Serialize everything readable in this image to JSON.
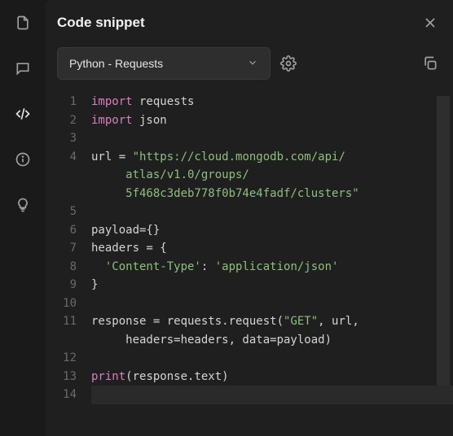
{
  "panel": {
    "title": "Code snippet"
  },
  "language_select": {
    "selected": "Python - Requests"
  },
  "code": {
    "lines": [
      {
        "n": 1,
        "segments": [
          {
            "cls": "kw",
            "t": "import"
          },
          {
            "cls": "ident",
            "t": " requests"
          }
        ]
      },
      {
        "n": 2,
        "segments": [
          {
            "cls": "kw",
            "t": "import"
          },
          {
            "cls": "ident",
            "t": " json"
          }
        ]
      },
      {
        "n": 3,
        "segments": [
          {
            "cls": "ident",
            "t": ""
          }
        ]
      },
      {
        "n": 4,
        "segments": [
          {
            "cls": "ident",
            "t": "url = "
          },
          {
            "cls": "str",
            "t": "\"https://cloud.mongodb.com/api/"
          }
        ]
      },
      {
        "n": "",
        "segments": [
          {
            "cls": "str",
            "t": "     atlas/v1.0/groups/"
          }
        ]
      },
      {
        "n": "",
        "segments": [
          {
            "cls": "str",
            "t": "     5f468c3deb778f0b74e4fadf/clusters\""
          }
        ]
      },
      {
        "n": 5,
        "segments": [
          {
            "cls": "ident",
            "t": ""
          }
        ]
      },
      {
        "n": 6,
        "segments": [
          {
            "cls": "ident",
            "t": "payload={}"
          }
        ]
      },
      {
        "n": 7,
        "segments": [
          {
            "cls": "ident",
            "t": "headers = {"
          }
        ]
      },
      {
        "n": 8,
        "segments": [
          {
            "cls": "ident",
            "t": "  "
          },
          {
            "cls": "str",
            "t": "'Content-Type'"
          },
          {
            "cls": "ident",
            "t": ": "
          },
          {
            "cls": "str",
            "t": "'application/json'"
          }
        ]
      },
      {
        "n": 9,
        "segments": [
          {
            "cls": "ident",
            "t": "}"
          }
        ]
      },
      {
        "n": 10,
        "segments": [
          {
            "cls": "ident",
            "t": ""
          }
        ]
      },
      {
        "n": 11,
        "segments": [
          {
            "cls": "ident",
            "t": "response = requests.request("
          },
          {
            "cls": "str",
            "t": "\"GET\""
          },
          {
            "cls": "ident",
            "t": ", url, "
          }
        ]
      },
      {
        "n": "",
        "segments": [
          {
            "cls": "ident",
            "t": "     headers=headers, data=payload)"
          }
        ]
      },
      {
        "n": 12,
        "segments": [
          {
            "cls": "ident",
            "t": ""
          }
        ]
      },
      {
        "n": 13,
        "segments": [
          {
            "cls": "kw",
            "t": "print"
          },
          {
            "cls": "ident",
            "t": "(response.text)"
          }
        ]
      },
      {
        "n": 14,
        "segments": [
          {
            "cls": "ident",
            "t": ""
          }
        ],
        "cursor": true
      }
    ]
  }
}
